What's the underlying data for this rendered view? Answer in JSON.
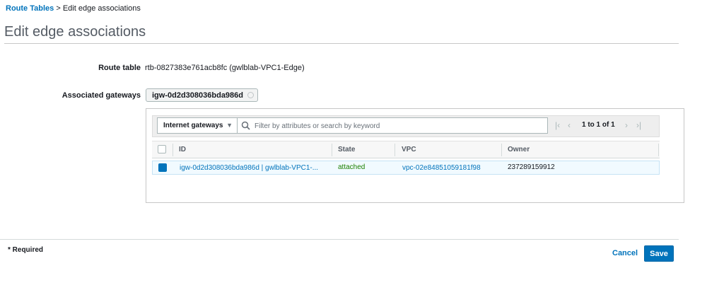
{
  "breadcrumb": {
    "parent": "Route Tables",
    "separator": ">",
    "current": "Edit edge associations"
  },
  "page_title": "Edit edge associations",
  "form": {
    "route_table": {
      "label": "Route table",
      "value": "rtb-0827383e761acb8fc (gwlblab-VPC1-Edge)"
    },
    "associated_gateways": {
      "label": "Associated gateways",
      "tokens": [
        "igw-0d2d308036bda986d"
      ]
    }
  },
  "selector": {
    "type_dropdown": {
      "selected": "Internet gateways"
    },
    "search": {
      "placeholder": "Filter by attributes or search by keyword",
      "value": ""
    },
    "pager": {
      "text": "1 to 1 of 1"
    },
    "table": {
      "columns": [
        "ID",
        "State",
        "VPC",
        "Owner"
      ],
      "rows": [
        {
          "selected": true,
          "id": "igw-0d2d308036bda986d | gwlblab-VPC1-...",
          "state": "attached",
          "vpc": "vpc-02e84851059181f98",
          "owner": "237289159912"
        }
      ]
    }
  },
  "footer": {
    "required_note": "* Required",
    "cancel_label": "Cancel",
    "save_label": "Save"
  },
  "colors": {
    "accent": "#0073bb",
    "status_ok": "#1d8102",
    "selected_row_bg": "#f1faff"
  },
  "icons": [
    "search-icon",
    "chevron-down-icon",
    "first-page-icon",
    "prev-page-icon",
    "next-page-icon",
    "last-page-icon",
    "remove-token-icon"
  ]
}
